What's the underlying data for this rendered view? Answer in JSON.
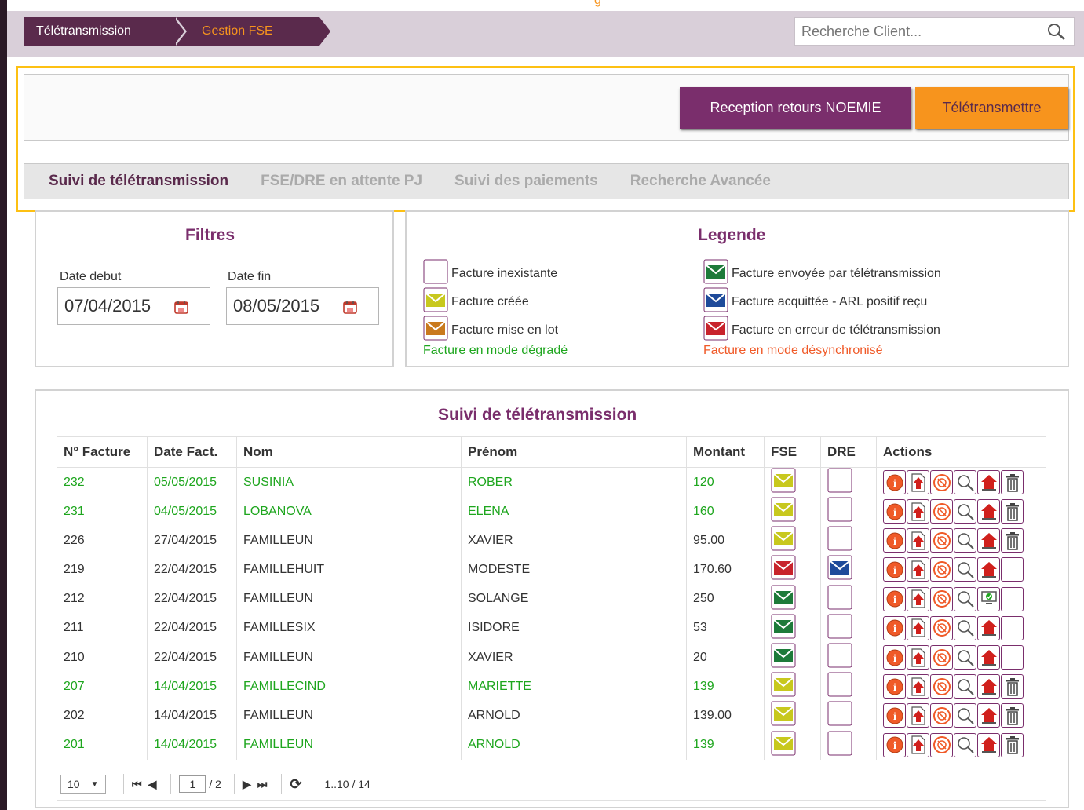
{
  "header": {
    "clipped_text": "g",
    "breadcrumbs": [
      "Télétransmission",
      "Gestion FSE"
    ],
    "search_placeholder": "Recherche Client..."
  },
  "actions": {
    "noemie_label": "Reception retours NOEMIE",
    "teletransmettre_label": "Télétransmettre"
  },
  "tabs": [
    {
      "label": "Suivi de télétransmission",
      "active": true
    },
    {
      "label": "FSE/DRE en attente PJ",
      "active": false
    },
    {
      "label": "Suivi des paiements",
      "active": false
    },
    {
      "label": "Recherche Avancée",
      "active": false
    }
  ],
  "filtres": {
    "title": "Filtres",
    "date_debut_label": "Date debut",
    "date_debut_value": "07/04/2015",
    "date_fin_label": "Date fin",
    "date_fin_value": "08/05/2015"
  },
  "legende": {
    "title": "Legende",
    "items": [
      {
        "label": "Facture inexistante",
        "icon": "empty-box"
      },
      {
        "label": "Facture créée",
        "icon": "envelope-yellow"
      },
      {
        "label": "Facture mise en lot",
        "icon": "envelope-orange"
      },
      {
        "label": "Facture envoyée par télétransmission",
        "icon": "envelope-green"
      },
      {
        "label": "Facture acquittée - ARL positif reçu",
        "icon": "envelope-blue"
      },
      {
        "label": "Facture en erreur de télétransmission",
        "icon": "envelope-red"
      }
    ],
    "degraded_note": "Facture en mode dégradé",
    "desync_note": "Facture en mode désynchronisé"
  },
  "suivi": {
    "title": "Suivi de télétransmission",
    "columns": [
      "N° Facture",
      "Date Fact.",
      "Nom",
      "Prénom",
      "Montant",
      "FSE",
      "DRE",
      "Actions"
    ],
    "rows": [
      {
        "num": "232",
        "date": "05/05/2015",
        "nom": "SUSINIA",
        "prenom": "ROBER",
        "montant": "120",
        "fse": "yellow",
        "dre": "empty",
        "status": "degrade",
        "last_action": "trash"
      },
      {
        "num": "231",
        "date": "04/05/2015",
        "nom": "LOBANOVA",
        "prenom": "ELENA",
        "montant": "160",
        "fse": "yellow",
        "dre": "empty",
        "status": "degrade",
        "last_action": "trash"
      },
      {
        "num": "226",
        "date": "27/04/2015",
        "nom": "FAMILLEUN",
        "prenom": "XAVIER",
        "montant": "95.00",
        "fse": "yellow",
        "dre": "empty",
        "status": "normal",
        "last_action": "trash"
      },
      {
        "num": "219",
        "date": "22/04/2015",
        "nom": "FAMILLEHUIT",
        "prenom": "MODESTE",
        "montant": "170.60",
        "fse": "red",
        "dre": "blue",
        "status": "normal",
        "last_action": "empty"
      },
      {
        "num": "212",
        "date": "22/04/2015",
        "nom": "FAMILLEUN",
        "prenom": "SOLANGE",
        "montant": "250",
        "fse": "green",
        "dre": "empty",
        "status": "normal",
        "last_action": "empty",
        "special_action": "pc-upload"
      },
      {
        "num": "211",
        "date": "22/04/2015",
        "nom": "FAMILLESIX",
        "prenom": "ISIDORE",
        "montant": "53",
        "fse": "green",
        "dre": "empty",
        "status": "normal",
        "last_action": "empty"
      },
      {
        "num": "210",
        "date": "22/04/2015",
        "nom": "FAMILLEUN",
        "prenom": "XAVIER",
        "montant": "20",
        "fse": "green",
        "dre": "empty",
        "status": "normal",
        "last_action": "empty"
      },
      {
        "num": "207",
        "date": "14/04/2015",
        "nom": "FAMILLECIND",
        "prenom": "MARIETTE",
        "montant": "139",
        "fse": "yellow",
        "dre": "empty",
        "status": "degrade",
        "last_action": "trash"
      },
      {
        "num": "202",
        "date": "14/04/2015",
        "nom": "FAMILLEUN",
        "prenom": "ARNOLD",
        "montant": "139.00",
        "fse": "yellow",
        "dre": "empty",
        "status": "normal",
        "last_action": "trash"
      },
      {
        "num": "201",
        "date": "14/04/2015",
        "nom": "FAMILLEUN",
        "prenom": "ARNOLD",
        "montant": "139",
        "fse": "yellow",
        "dre": "empty",
        "status": "degrade",
        "last_action": "trash"
      }
    ]
  },
  "pager": {
    "page_size": "10",
    "current_page": "1",
    "total_pages": "/ 2",
    "range": "1..10 / 14"
  },
  "colors": {
    "brand_purple": "#7a2e6c",
    "brand_orange": "#f7941d",
    "degraded_green": "#1ea61e",
    "desync_orange": "#f05a28",
    "highlight_yellow": "#fdc013"
  }
}
